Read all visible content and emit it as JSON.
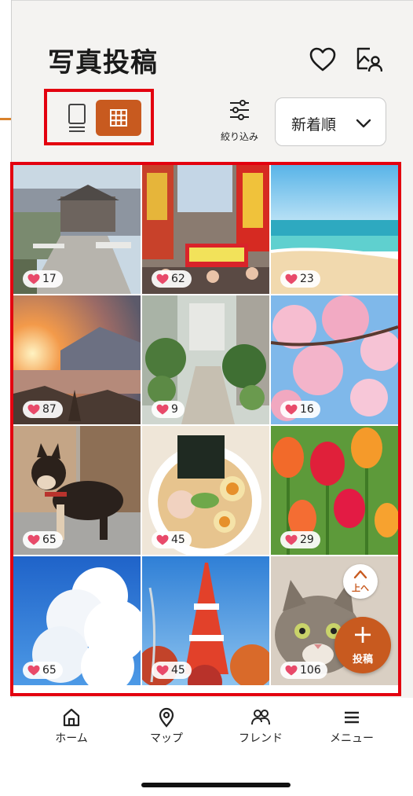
{
  "header": {
    "title": "写真投稿",
    "icons": [
      "heart-icon",
      "gallery-person-icon"
    ]
  },
  "toolbar": {
    "view_modes": [
      "list-view-icon",
      "grid-view-icon"
    ],
    "active_view": "grid",
    "filter_label": "絞り込み",
    "sort_label": "新着順"
  },
  "photos": [
    {
      "subject": "town-street",
      "likes": "17"
    },
    {
      "subject": "dotonbori",
      "likes": "62"
    },
    {
      "subject": "beach",
      "likes": "23"
    },
    {
      "subject": "lake-sunset",
      "likes": "87"
    },
    {
      "subject": "garden-alley",
      "likes": "9"
    },
    {
      "subject": "cherry-blossom",
      "likes": "16"
    },
    {
      "subject": "shiba-dog",
      "likes": "65"
    },
    {
      "subject": "ramen",
      "likes": "45"
    },
    {
      "subject": "tulips",
      "likes": "29"
    },
    {
      "subject": "clouds",
      "likes": "65"
    },
    {
      "subject": "tokyo-tower",
      "likes": "45"
    },
    {
      "subject": "cat",
      "likes": "106"
    }
  ],
  "scroll_top_label": "上へ",
  "post_button_label": "投稿",
  "nav": [
    {
      "label": "ホーム",
      "icon": "home-icon"
    },
    {
      "label": "マップ",
      "icon": "map-pin-icon"
    },
    {
      "label": "フレンド",
      "icon": "friends-icon"
    },
    {
      "label": "メニュー",
      "icon": "menu-icon"
    }
  ],
  "colors": {
    "accent": "#c85a1f",
    "highlight_border": "#e3000f",
    "annotation_arrow": "#d9822b",
    "background": "#f4f3f1"
  }
}
